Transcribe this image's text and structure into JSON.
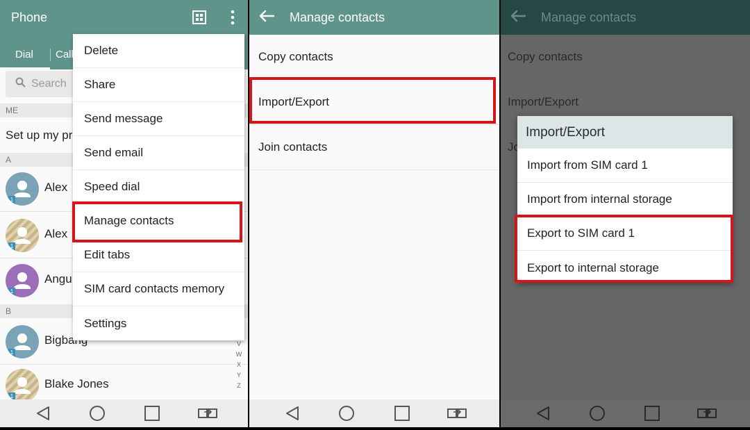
{
  "panel1": {
    "appbar": {
      "title": "Phone"
    },
    "tabs": [
      {
        "label": "Dial"
      },
      {
        "label": "Call"
      }
    ],
    "search": {
      "placeholder": "Search"
    },
    "sections": {
      "me": "ME",
      "a": "A",
      "b": "B"
    },
    "profile_row": "Set up my pr",
    "contacts": [
      {
        "name": "Alex",
        "avatar_color": "#7ba3b8",
        "avatar_style": "plain"
      },
      {
        "name": "Alex",
        "avatar_color": "#c8b48a",
        "avatar_style": "striped"
      },
      {
        "name": "Angu",
        "avatar_color": "#9b6fb8",
        "avatar_style": "plain"
      },
      {
        "name": "Bigbang",
        "avatar_color": "#7ba3b8",
        "avatar_style": "plain"
      },
      {
        "name": "Blake Jones",
        "avatar_color": "#c8b48a",
        "avatar_style": "striped"
      }
    ],
    "sim_badge": "1",
    "alpha_index": [
      "V",
      "W",
      "X",
      "Y",
      "Z"
    ],
    "menu": [
      "Delete",
      "Share",
      "Send message",
      "Send email",
      "Speed dial",
      "Manage contacts",
      "Edit tabs",
      "SIM card contacts memory",
      "Settings"
    ]
  },
  "panel2": {
    "appbar": {
      "title": "Manage contacts"
    },
    "items": [
      "Copy contacts",
      "Import/Export",
      "Join contacts"
    ]
  },
  "panel3": {
    "appbar": {
      "title": "Manage contacts"
    },
    "background_items": [
      "Copy contacts",
      "Import/Export",
      "Jo"
    ],
    "dialog": {
      "title": "Import/Export",
      "items": [
        "Import from SIM card 1",
        "Import from internal storage",
        "Export to SIM card 1",
        "Export to internal storage"
      ]
    }
  },
  "colors": {
    "appbar": "#5f948b",
    "appbar_dimmed": "#264844",
    "highlight": "#d7141a",
    "dim_overlay": "#666666"
  },
  "navbar_icons": [
    "back-icon",
    "home-icon",
    "recents-icon",
    "dual-window-icon"
  ]
}
